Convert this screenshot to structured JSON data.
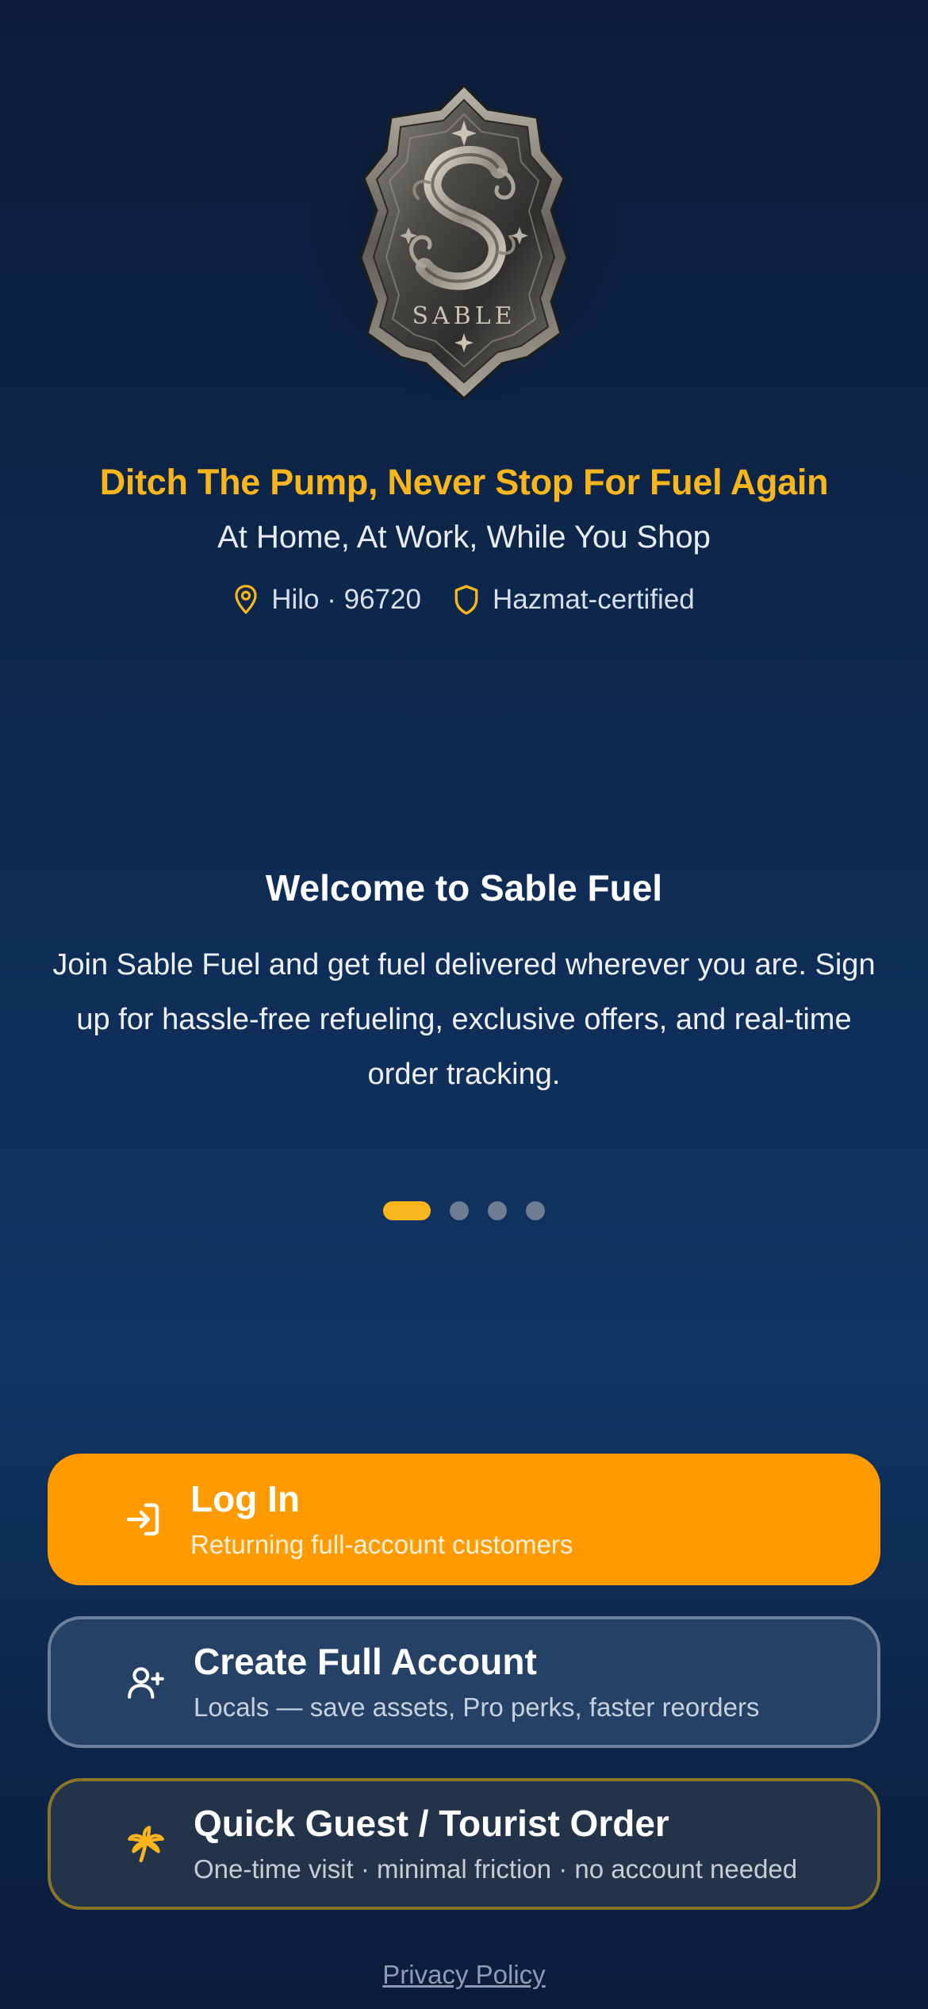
{
  "brand": {
    "logo_text": "SABLE",
    "logo_icon": "sable-shield-crest"
  },
  "hero": {
    "tagline": "Ditch The Pump, Never Stop For Fuel Again",
    "subtagline": "At Home, At Work, While You Shop",
    "location": "Hilo · 96720",
    "certification": "Hazmat-certified"
  },
  "carousel": {
    "title": "Welcome to Sable Fuel",
    "body": "Join Sable Fuel and get fuel delivered wherever you are. Sign up for hassle-free refueling, exclusive offers, and real-time order tracking.",
    "page_count": 4,
    "active_index": 0
  },
  "actions": {
    "login": {
      "title": "Log In",
      "subtitle": "Returning full-account customers",
      "icon": "login-arrow-icon"
    },
    "create": {
      "title": "Create Full Account",
      "subtitle": "Locals — save assets, Pro perks, faster reorders",
      "icon": "user-plus-icon"
    },
    "guest": {
      "title": "Quick Guest / Tourist Order",
      "subtitle": "One-time visit · minimal friction · no account needed",
      "icon": "palm-tree-icon"
    }
  },
  "footer": {
    "privacy_label": "Privacy Policy"
  },
  "colors": {
    "accent": "#f8b61c",
    "login_button": "#ff9b00",
    "create_button": "#254166",
    "guest_button": "#23334a",
    "background_top": "#0b1d38",
    "background_mid": "#103564"
  }
}
